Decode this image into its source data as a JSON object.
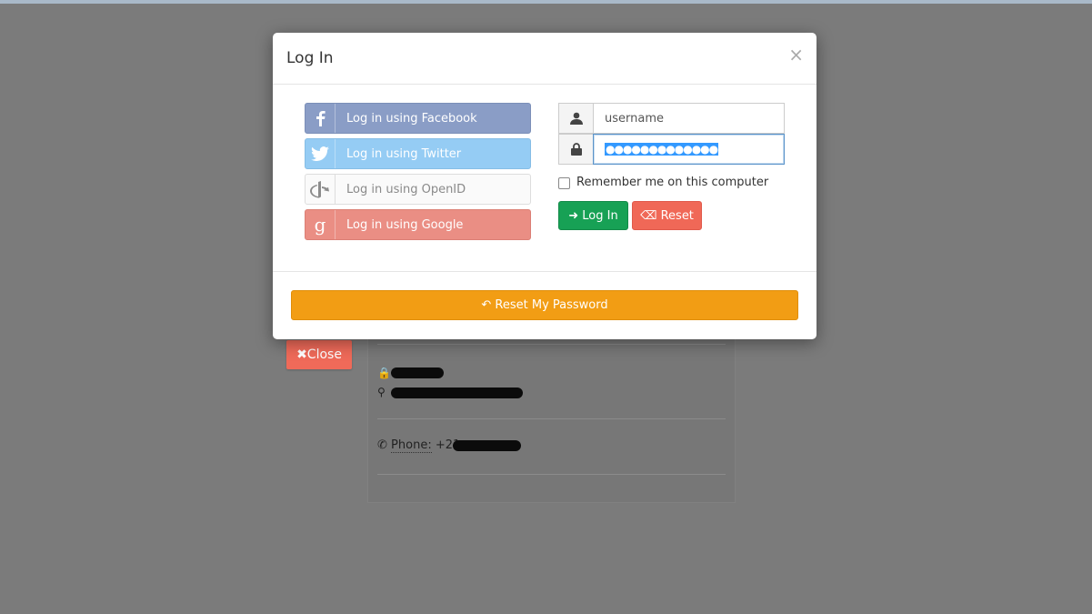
{
  "modal": {
    "title": "Log In",
    "close_glyph": "×",
    "social": {
      "facebook": {
        "label": "Log in using Facebook",
        "icon": "facebook-icon",
        "color": "#8a9dc6"
      },
      "twitter": {
        "label": "Log in using Twitter",
        "icon": "twitter-icon",
        "color": "#95ccf4"
      },
      "openid": {
        "label": "Log in using OpenID",
        "icon": "openid-icon",
        "color": "#fafafa"
      },
      "google": {
        "label": "Log in using Google",
        "icon": "google-icon",
        "color": "#ea8e84"
      }
    },
    "username": {
      "value": "username",
      "icon": "user-icon"
    },
    "password": {
      "value": "●●●●●●●●●●●●●",
      "icon": "lock-icon"
    },
    "remember_label": "Remember me on this computer",
    "login_label": "Log In",
    "reset_label": "Reset",
    "reset_password_label": "Reset My Password"
  },
  "background": {
    "close_label": "Close",
    "phone_label": "Phone:",
    "phone_value": "+21"
  },
  "colors": {
    "login": "#17a155",
    "reset": "#f06857",
    "reset_password": "#f29d14",
    "overlay": "#7b7b7b"
  }
}
